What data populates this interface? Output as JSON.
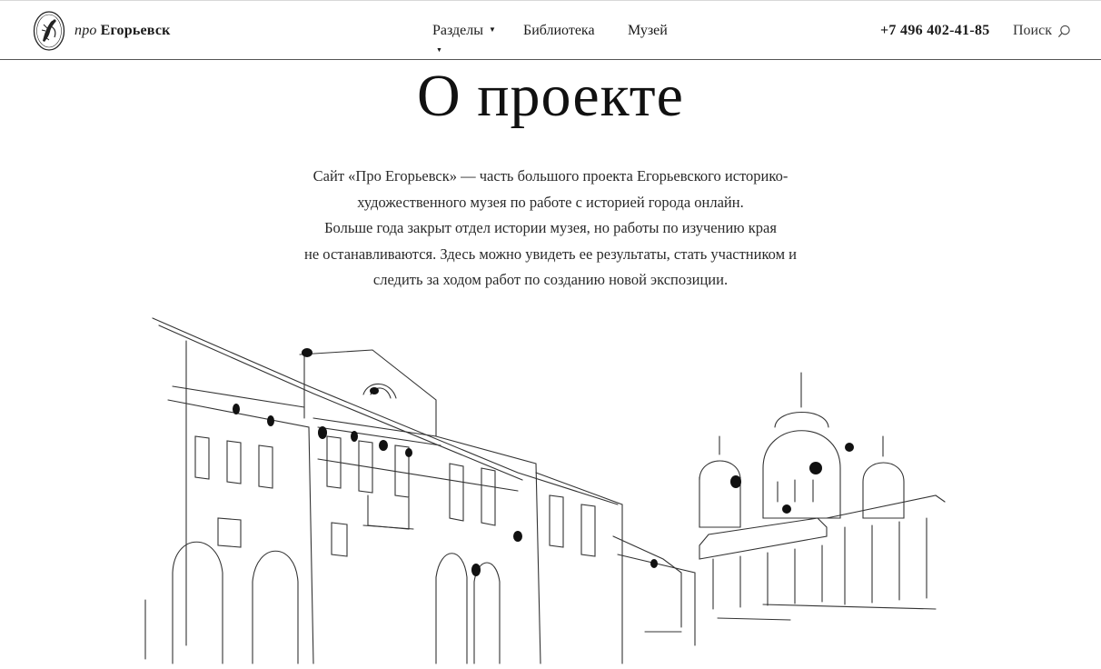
{
  "header": {
    "logo": {
      "prefix": "про",
      "city": "Егорьевск"
    },
    "nav": [
      {
        "label": "Разделы",
        "has_dropdown": true
      },
      {
        "label": "Библиотека"
      },
      {
        "label": "Музей"
      }
    ],
    "phone": "+7 496 402-41-85",
    "search_label": "Поиск"
  },
  "main": {
    "title": "О проекте",
    "intro_lines": [
      "Сайт «Про Егорьевск» — часть большого проекта Егорьевского историко-",
      "художественного музея по работе с историей города онлайн.",
      "Больше года закрыт отдел истории музея, но работы по изучению края",
      "не останавливаются. Здесь можно увидеть ее результаты, стать участником и",
      "следить за ходом работ по созданию новой экспозиции."
    ]
  },
  "colors": {
    "text": "#1a1a1a",
    "header_border": "#555555",
    "background": "#ffffff"
  },
  "icons": {
    "logo": "city-emblem-icon",
    "search": "search-icon",
    "dropdown": "caret-down-icon",
    "illustration": "city-street-sketch"
  }
}
